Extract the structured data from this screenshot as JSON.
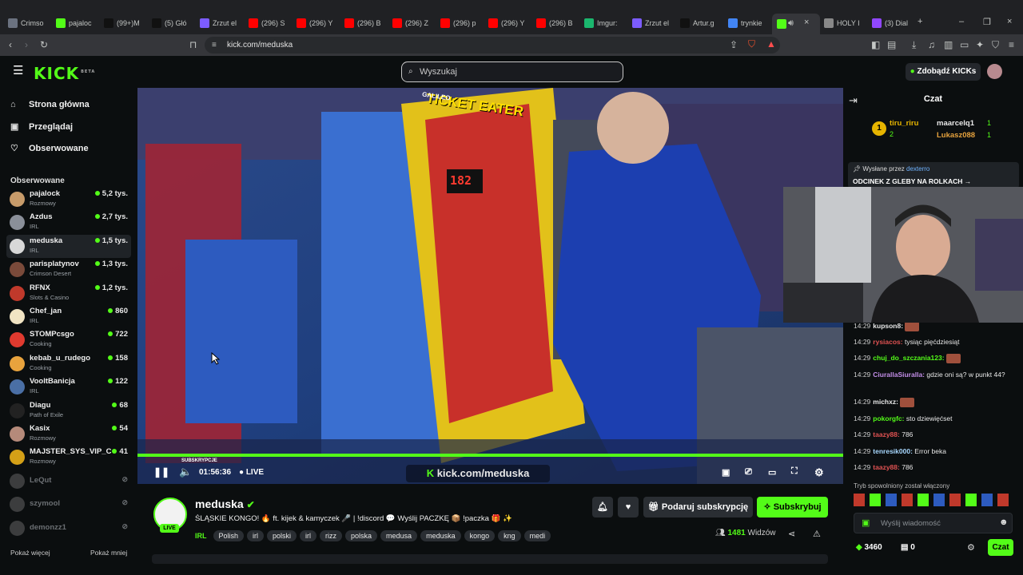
{
  "browser": {
    "tabs": [
      {
        "label": "Crimso",
        "color": "#6b7280"
      },
      {
        "label": "pajaloc",
        "color": "#53fc18"
      },
      {
        "label": "(99+)M",
        "color": "#111111"
      },
      {
        "label": "(5) Głó",
        "color": "#111111"
      },
      {
        "label": "Zrzut el",
        "color": "#7c5cff"
      },
      {
        "label": "(296) S",
        "color": "#ff0000"
      },
      {
        "label": "(296) Y",
        "color": "#ff0000"
      },
      {
        "label": "(296) B",
        "color": "#ff0000"
      },
      {
        "label": "(296) Z",
        "color": "#ff0000"
      },
      {
        "label": "(296) p",
        "color": "#ff0000"
      },
      {
        "label": "(296) Y",
        "color": "#ff0000"
      },
      {
        "label": "(296) B",
        "color": "#ff0000"
      },
      {
        "label": "Imgur:",
        "color": "#1bb76e"
      },
      {
        "label": "Zrzut el",
        "color": "#7c5cff"
      },
      {
        "label": "Artur.g",
        "color": "#111111"
      },
      {
        "label": "trynkie",
        "color": "#4285f4"
      },
      {
        "label": "",
        "color": "#53fc18"
      },
      {
        "label": "HOLY I",
        "color": "#888888"
      },
      {
        "label": "(3) Dial",
        "color": "#9147ff"
      }
    ],
    "url": "kick.com/meduska"
  },
  "header": {
    "logo": "KICK",
    "logo_beta": "BETA",
    "search_placeholder": "Wyszukaj",
    "kicks_button": "Zdobądź KICKs"
  },
  "sidebar": {
    "nav": [
      {
        "label": "Strona główna",
        "icon": "home-icon",
        "glyph": "⌂"
      },
      {
        "label": "Przeglądaj",
        "icon": "browse-icon",
        "glyph": "▣"
      },
      {
        "label": "Obserwowane",
        "icon": "heart-icon",
        "glyph": "♡"
      }
    ],
    "following_title": "Obserwowane",
    "following": [
      {
        "name": "pajalock",
        "category": "Rozmowy",
        "viewers": "5,2 tys.",
        "color": "#c79b6a",
        "live": true
      },
      {
        "name": "Azdus",
        "category": "IRL",
        "viewers": "2,7 tys.",
        "color": "#8a8f99",
        "live": true
      },
      {
        "name": "meduska",
        "category": "IRL",
        "viewers": "1,5 tys.",
        "color": "#d8d8d8",
        "live": true,
        "active": true
      },
      {
        "name": "parisplatynov",
        "category": "Crimson Desert",
        "viewers": "1,3 tys.",
        "color": "#7a4a3a",
        "live": true
      },
      {
        "name": "RFNX",
        "category": "Slots & Casino",
        "viewers": "1,2 tys.",
        "color": "#c0392b",
        "live": true
      },
      {
        "name": "Chef_jan",
        "category": "IRL",
        "viewers": "860",
        "color": "#f1e4c3",
        "live": true
      },
      {
        "name": "STOMPcsgo",
        "category": "Cooking",
        "viewers": "722",
        "color": "#e03a2f",
        "live": true
      },
      {
        "name": "kebab_u_rudego",
        "category": "Cooking",
        "viewers": "158",
        "color": "#e8a33d",
        "live": true
      },
      {
        "name": "VooltBanicja",
        "category": "IRL",
        "viewers": "122",
        "color": "#4a6fa5",
        "live": true
      },
      {
        "name": "Diagu",
        "category": "Path of Exile",
        "viewers": "68",
        "color": "#222222",
        "live": true
      },
      {
        "name": "Kasix",
        "category": "Rozmowy",
        "viewers": "54",
        "color": "#b58a7a",
        "live": true
      },
      {
        "name": "MAJSTER_SYS_VIP_C",
        "category": "Rozmowy",
        "viewers": "41",
        "color": "#d4a017",
        "live": true
      },
      {
        "name": "LeQut",
        "category": "",
        "viewers": "",
        "color": "#777777",
        "live": false
      },
      {
        "name": "szymool",
        "category": "",
        "viewers": "",
        "color": "#777777",
        "live": false
      },
      {
        "name": "demonzz1",
        "category": "",
        "viewers": "",
        "color": "#777777",
        "live": false
      }
    ],
    "show_more": "Pokaż więcej",
    "show_less": "Pokaż mniej"
  },
  "player": {
    "sub_label": "SUBSKRYPCJE",
    "time": "01:56:36",
    "live": "LIVE",
    "watermark": "kick.com/meduska",
    "machine_title": "TICKET EATER",
    "machine_brand": "GALILEO",
    "counter": "182",
    "progress": 1.0
  },
  "channel": {
    "name": "meduska",
    "live_badge": "LIVE",
    "title": "ŚLĄSKIE KONGO! 🔥 ft. kijek & kamyczek 🎤 | !discord 💬 Wyślij PACZKĘ 📦 !paczka 🎁 ✨",
    "category": "IRL",
    "tags": [
      "Polish",
      "irl",
      "polski",
      "irl",
      "rizz",
      "polska",
      "medusa",
      "meduska",
      "kongo",
      "kng",
      "medi"
    ],
    "viewers": "1481",
    "viewers_label": "Widzów",
    "gift_button": "Podaruj subskrypcję",
    "subscribe_button": "Subskrybuj"
  },
  "chat": {
    "title": "Czat",
    "leaders": [
      {
        "rank": "1",
        "name": "tiru_riru",
        "count": "2"
      },
      {
        "rank": "",
        "name": "maarcelq1",
        "count": "1"
      },
      {
        "rank": "",
        "name": "Lukasz088",
        "count": "1"
      }
    ],
    "pinned_by_label": "Wysłane przez",
    "pinned_by": "dexterro",
    "pinned_text": "ODCINEK Z GLEBY NA ROLKACH →",
    "messages": [
      {
        "time": "14:29",
        "user": "kupson8:",
        "text": "",
        "color": "#e8e8e8"
      },
      {
        "time": "14:29",
        "user": "rysiacos:",
        "text": "tysiąc pięćdziesiąt",
        "color": "#e05252"
      },
      {
        "time": "14:29",
        "user": "chuj_do_szczania123:",
        "text": "",
        "color": "#53fc18"
      },
      {
        "time": "14:29",
        "user": "CiurallaSiuralla:",
        "text": "gdzie oni są? w punkt 44?",
        "color": "#c38ee8"
      },
      {
        "time": "14:29",
        "user": "michxz:",
        "text": "",
        "color": "#e8e8e8"
      },
      {
        "time": "14:29",
        "user": "pokorgfc:",
        "text": "sto dziewięćset",
        "color": "#53fc18"
      },
      {
        "time": "14:29",
        "user": "taazy88:",
        "text": "786",
        "color": "#e05252"
      },
      {
        "time": "14:29",
        "user": "tenresik000:",
        "text": "Error beka",
        "color": "#a8d8ff"
      },
      {
        "time": "14:29",
        "user": "taazy88:",
        "text": "786",
        "color": "#e05252"
      }
    ],
    "slow_mode": "Tryb spowolniony został włączony",
    "input_placeholder": "Wyślij wiadomość",
    "points": "3460",
    "gifts": "0",
    "send_button": "Czat"
  }
}
